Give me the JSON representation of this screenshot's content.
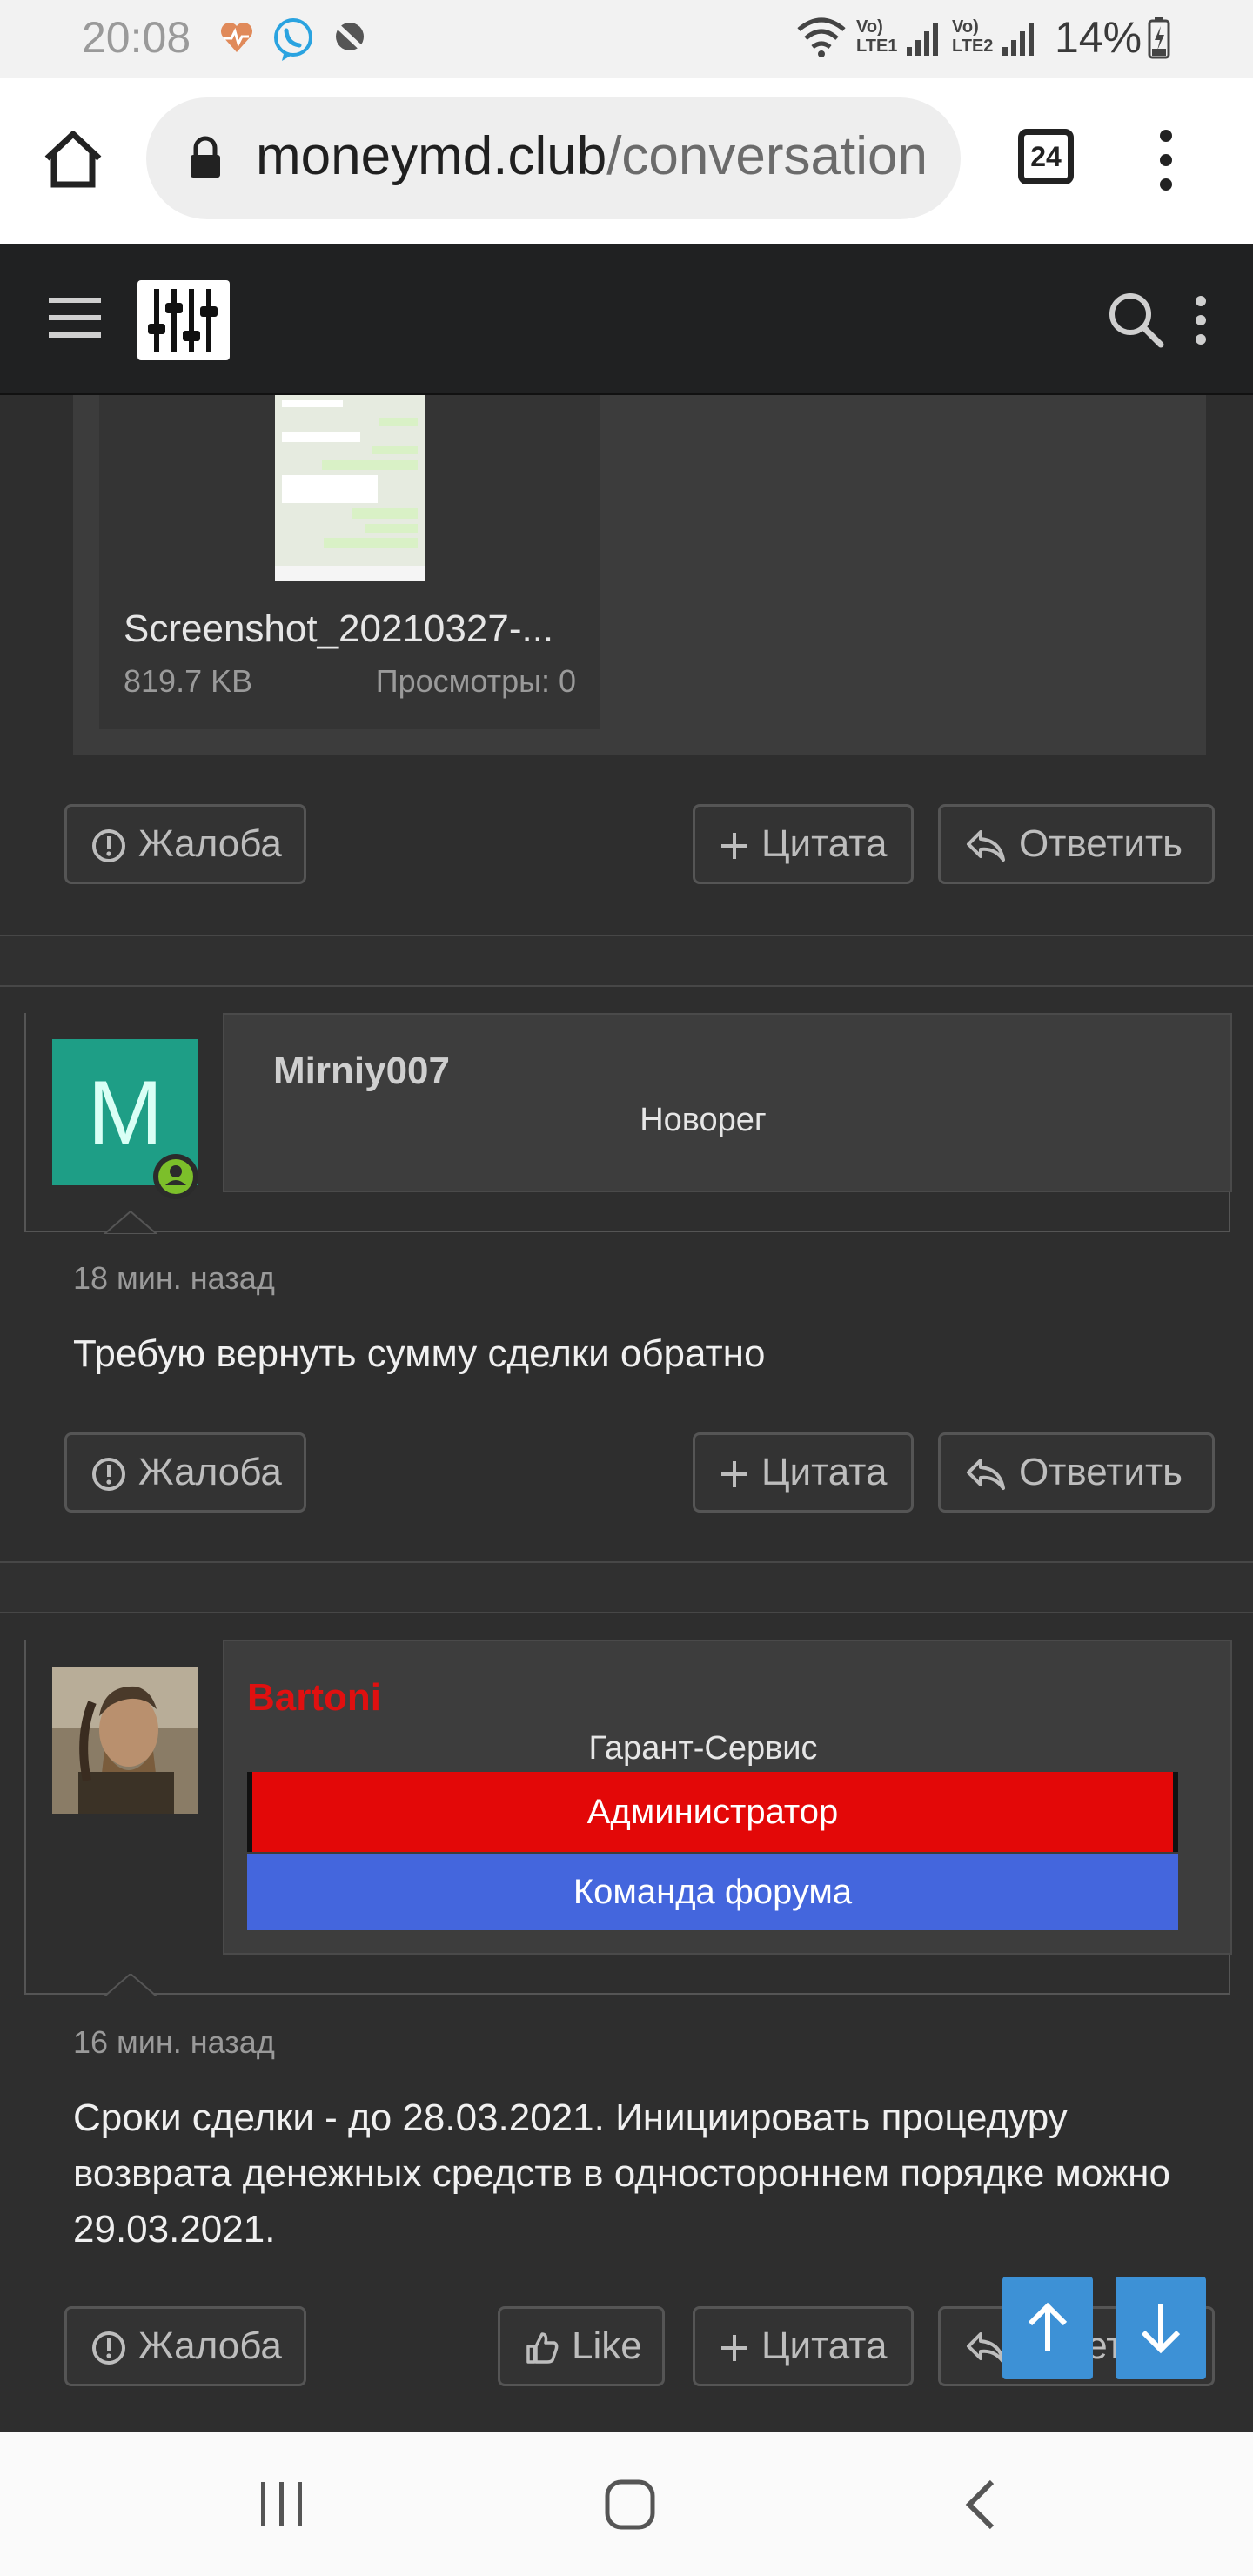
{
  "status_bar": {
    "time": "20:08",
    "signal_text": "Vo) LTE1 Vo) LTE2",
    "battery": "14%"
  },
  "browser": {
    "url_domain": "moneymd.club",
    "url_path": "/conversation",
    "tab_count": "24"
  },
  "attachment": {
    "filename": "Screenshot_20210327-...",
    "size": "819.7 KB",
    "views": "Просмотры: 0"
  },
  "actions": {
    "report": "Жалоба",
    "quote": "Цитата",
    "reply": "Ответить",
    "like": "Like",
    "reply_partial": "Ответ"
  },
  "posts": [
    {
      "avatar_letter": "M",
      "username": "Mirniy007",
      "user_title": "Новорег",
      "time": "18 мин. назад",
      "message": "Требую вернуть сумму сделки обратно"
    },
    {
      "username": "Bartoni",
      "user_title": "Гарант-Сервис",
      "banner_admin": "Администратор",
      "banner_team": "Команда форума",
      "time": "16 мин. назад",
      "message": "Сроки сделки - до 28.03.2021. Инициировать процедуру возврата денежных средств в одностороннем порядке можно 29.03.2021."
    }
  ],
  "colors": {
    "username_red": "#e01010",
    "admin_banner": "#e30808",
    "team_banner": "#4466dd",
    "fab_blue": "#3d91d6",
    "online_green": "#7cbf2a"
  },
  "icons": [
    "heart-pulse-icon",
    "viber-icon",
    "muted-icon",
    "wifi-icon",
    "signal-icon",
    "battery-icon",
    "home-icon",
    "lock-icon",
    "more-vert-icon",
    "hamburger-icon",
    "search-icon",
    "report-icon",
    "plus-icon",
    "reply-icon",
    "like-icon",
    "arrow-up-icon",
    "arrow-down-icon",
    "recents-icon",
    "home-nav-icon",
    "back-icon"
  ]
}
